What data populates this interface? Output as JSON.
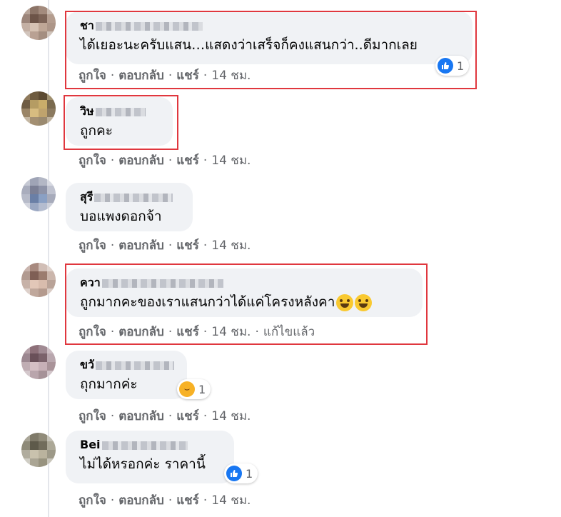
{
  "actions": {
    "like": "ถูกใจ",
    "reply": "ตอบกลับ",
    "share": "แชร์",
    "dot": "·"
  },
  "comments": [
    {
      "name": "ชา",
      "text": "ได้เยอะนะครับแสน…แสดงว่าเสร็จก็คงแสนกว่า..ดีมากเลย",
      "time": "14 ชม.",
      "reaction": {
        "icon": "like-icon",
        "count": "1"
      }
    },
    {
      "name": "วิษ",
      "text": "ถูกคะ",
      "time": "14 ชม."
    },
    {
      "name": "สุรี",
      "text": "บอแพงดอกจ้า",
      "time": "14 ชม."
    },
    {
      "name": "ควา",
      "text": "ถูกมากคะของเราแสนกว่าได้แค่โครงหลังคา",
      "time": "14 ชม.",
      "edited": "แก้ไขแล้ว"
    },
    {
      "name": "ขวั",
      "text": "ถุกมากค่ะ",
      "time": "14 ชม.",
      "reaction": {
        "icon": "haha-icon",
        "count": "1"
      }
    },
    {
      "name": "Bei",
      "text": "ไม่ได้หรอกค่ะ ราคานี้",
      "time": "14 ชม.",
      "reaction": {
        "icon": "like-icon",
        "count": "1"
      }
    }
  ],
  "colors": {
    "highlight": "#e0373e",
    "bubble": "#f0f2f5",
    "like_blue": "#1877f2",
    "meta_gray": "#65676b"
  }
}
